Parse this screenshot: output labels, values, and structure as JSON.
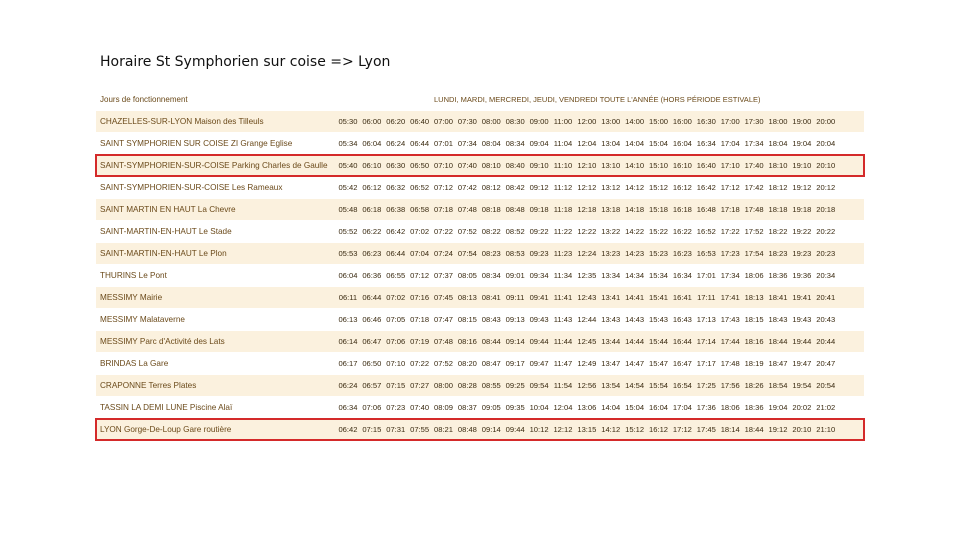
{
  "title": "Horaire St Symphorien sur coise => Lyon",
  "table": {
    "header_label": "Jours de fonctionnement",
    "header_days": "LUNDI, MARDI, MERCREDI, JEUDI, VENDREDI TOUTE L'ANNÉE (HORS PÉRIODE ESTIVALE)",
    "rows": [
      {
        "stop": "CHAZELLES-SUR-LYON Maison des Tilleuls",
        "highlight": false,
        "times": [
          "05:30",
          "06:00",
          "06:20",
          "06:40",
          "07:00",
          "07:30",
          "08:00",
          "08:30",
          "09:00",
          "11:00",
          "12:00",
          "13:00",
          "14:00",
          "15:00",
          "16:00",
          "16:30",
          "17:00",
          "17:30",
          "18:00",
          "19:00",
          "20:00"
        ]
      },
      {
        "stop": "SAINT SYMPHORIEN SUR COISE ZI Grange Eglise",
        "highlight": false,
        "times": [
          "05:34",
          "06:04",
          "06:24",
          "06:44",
          "07:01",
          "07:34",
          "08:04",
          "08:34",
          "09:04",
          "11:04",
          "12:04",
          "13:04",
          "14:04",
          "15:04",
          "16:04",
          "16:34",
          "17:04",
          "17:34",
          "18:04",
          "19:04",
          "20:04"
        ]
      },
      {
        "stop": "SAINT-SYMPHORIEN-SUR-COISE Parking Charles de Gaulle",
        "highlight": true,
        "times": [
          "05:40",
          "06:10",
          "06:30",
          "06:50",
          "07:10",
          "07:40",
          "08:10",
          "08:40",
          "09:10",
          "11:10",
          "12:10",
          "13:10",
          "14:10",
          "15:10",
          "16:10",
          "16:40",
          "17:10",
          "17:40",
          "18:10",
          "19:10",
          "20:10"
        ]
      },
      {
        "stop": "SAINT-SYMPHORIEN-SUR-COISE Les Rameaux",
        "highlight": false,
        "times": [
          "05:42",
          "06:12",
          "06:32",
          "06:52",
          "07:12",
          "07:42",
          "08:12",
          "08:42",
          "09:12",
          "11:12",
          "12:12",
          "13:12",
          "14:12",
          "15:12",
          "16:12",
          "16:42",
          "17:12",
          "17:42",
          "18:12",
          "19:12",
          "20:12"
        ]
      },
      {
        "stop": "SAINT MARTIN EN HAUT La Chevre",
        "highlight": false,
        "times": [
          "05:48",
          "06:18",
          "06:38",
          "06:58",
          "07:18",
          "07:48",
          "08:18",
          "08:48",
          "09:18",
          "11:18",
          "12:18",
          "13:18",
          "14:18",
          "15:18",
          "16:18",
          "16:48",
          "17:18",
          "17:48",
          "18:18",
          "19:18",
          "20:18"
        ]
      },
      {
        "stop": "SAINT-MARTIN-EN-HAUT Le Stade",
        "highlight": false,
        "times": [
          "05:52",
          "06:22",
          "06:42",
          "07:02",
          "07:22",
          "07:52",
          "08:22",
          "08:52",
          "09:22",
          "11:22",
          "12:22",
          "13:22",
          "14:22",
          "15:22",
          "16:22",
          "16:52",
          "17:22",
          "17:52",
          "18:22",
          "19:22",
          "20:22"
        ]
      },
      {
        "stop": "SAINT-MARTIN-EN-HAUT Le Plon",
        "highlight": false,
        "times": [
          "05:53",
          "06:23",
          "06:44",
          "07:04",
          "07:24",
          "07:54",
          "08:23",
          "08:53",
          "09:23",
          "11:23",
          "12:24",
          "13:23",
          "14:23",
          "15:23",
          "16:23",
          "16:53",
          "17:23",
          "17:54",
          "18:23",
          "19:23",
          "20:23"
        ]
      },
      {
        "stop": "THURINS Le Pont",
        "highlight": false,
        "times": [
          "06:04",
          "06:36",
          "06:55",
          "07:12",
          "07:37",
          "08:05",
          "08:34",
          "09:01",
          "09:34",
          "11:34",
          "12:35",
          "13:34",
          "14:34",
          "15:34",
          "16:34",
          "17:01",
          "17:34",
          "18:06",
          "18:36",
          "19:36",
          "20:34"
        ]
      },
      {
        "stop": "MESSIMY Mairie",
        "highlight": false,
        "times": [
          "06:11",
          "06:44",
          "07:02",
          "07:16",
          "07:45",
          "08:13",
          "08:41",
          "09:11",
          "09:41",
          "11:41",
          "12:43",
          "13:41",
          "14:41",
          "15:41",
          "16:41",
          "17:11",
          "17:41",
          "18:13",
          "18:41",
          "19:41",
          "20:41"
        ]
      },
      {
        "stop": "MESSIMY Malataverne",
        "highlight": false,
        "times": [
          "06:13",
          "06:46",
          "07:05",
          "07:18",
          "07:47",
          "08:15",
          "08:43",
          "09:13",
          "09:43",
          "11:43",
          "12:44",
          "13:43",
          "14:43",
          "15:43",
          "16:43",
          "17:13",
          "17:43",
          "18:15",
          "18:43",
          "19:43",
          "20:43"
        ]
      },
      {
        "stop": "MESSIMY Parc d'Activité des Lats",
        "highlight": false,
        "times": [
          "06:14",
          "06:47",
          "07:06",
          "07:19",
          "07:48",
          "08:16",
          "08:44",
          "09:14",
          "09:44",
          "11:44",
          "12:45",
          "13:44",
          "14:44",
          "15:44",
          "16:44",
          "17:14",
          "17:44",
          "18:16",
          "18:44",
          "19:44",
          "20:44"
        ]
      },
      {
        "stop": "BRINDAS La Gare",
        "highlight": false,
        "times": [
          "06:17",
          "06:50",
          "07:10",
          "07:22",
          "07:52",
          "08:20",
          "08:47",
          "09:17",
          "09:47",
          "11:47",
          "12:49",
          "13:47",
          "14:47",
          "15:47",
          "16:47",
          "17:17",
          "17:48",
          "18:19",
          "18:47",
          "19:47",
          "20:47"
        ]
      },
      {
        "stop": "CRAPONNE Terres Plates",
        "highlight": false,
        "times": [
          "06:24",
          "06:57",
          "07:15",
          "07:27",
          "08:00",
          "08:28",
          "08:55",
          "09:25",
          "09:54",
          "11:54",
          "12:56",
          "13:54",
          "14:54",
          "15:54",
          "16:54",
          "17:25",
          "17:56",
          "18:26",
          "18:54",
          "19:54",
          "20:54"
        ]
      },
      {
        "stop": "TASSIN LA DEMI LUNE Piscine Alaï",
        "highlight": false,
        "times": [
          "06:34",
          "07:06",
          "07:23",
          "07:40",
          "08:09",
          "08:37",
          "09:05",
          "09:35",
          "10:04",
          "12:04",
          "13:06",
          "14:04",
          "15:04",
          "16:04",
          "17:04",
          "17:36",
          "18:06",
          "18:36",
          "19:04",
          "20:02",
          "21:02"
        ]
      },
      {
        "stop": "LYON Gorge-De-Loup Gare routière",
        "highlight": true,
        "times": [
          "06:42",
          "07:15",
          "07:31",
          "07:55",
          "08:21",
          "08:48",
          "09:14",
          "09:44",
          "10:12",
          "12:12",
          "13:15",
          "14:12",
          "15:12",
          "16:12",
          "17:12",
          "17:45",
          "18:14",
          "18:44",
          "19:12",
          "20:10",
          "21:10"
        ]
      }
    ]
  }
}
